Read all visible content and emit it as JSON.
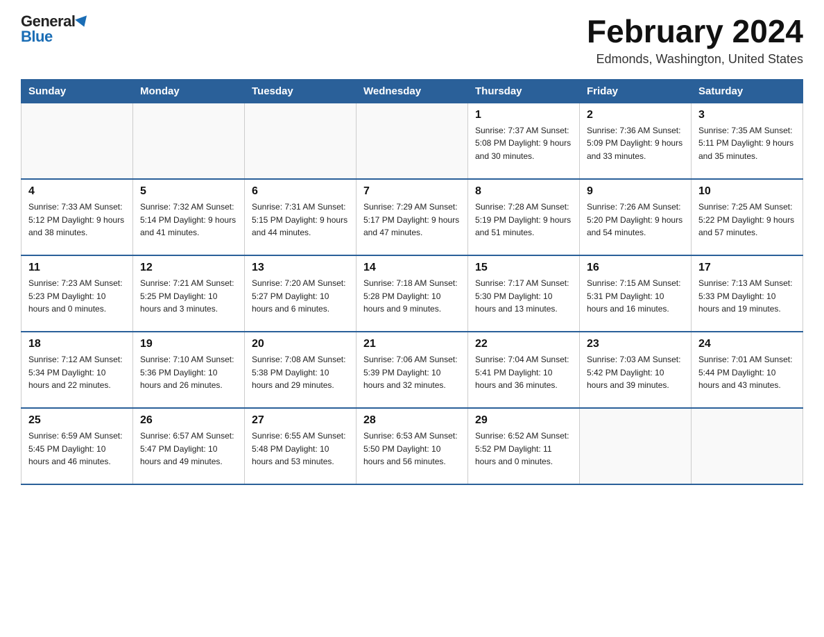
{
  "header": {
    "logo_general": "General",
    "logo_blue": "Blue",
    "title": "February 2024",
    "subtitle": "Edmonds, Washington, United States"
  },
  "days_of_week": [
    "Sunday",
    "Monday",
    "Tuesday",
    "Wednesday",
    "Thursday",
    "Friday",
    "Saturday"
  ],
  "weeks": [
    [
      {
        "day": "",
        "info": ""
      },
      {
        "day": "",
        "info": ""
      },
      {
        "day": "",
        "info": ""
      },
      {
        "day": "",
        "info": ""
      },
      {
        "day": "1",
        "info": "Sunrise: 7:37 AM\nSunset: 5:08 PM\nDaylight: 9 hours\nand 30 minutes."
      },
      {
        "day": "2",
        "info": "Sunrise: 7:36 AM\nSunset: 5:09 PM\nDaylight: 9 hours\nand 33 minutes."
      },
      {
        "day": "3",
        "info": "Sunrise: 7:35 AM\nSunset: 5:11 PM\nDaylight: 9 hours\nand 35 minutes."
      }
    ],
    [
      {
        "day": "4",
        "info": "Sunrise: 7:33 AM\nSunset: 5:12 PM\nDaylight: 9 hours\nand 38 minutes."
      },
      {
        "day": "5",
        "info": "Sunrise: 7:32 AM\nSunset: 5:14 PM\nDaylight: 9 hours\nand 41 minutes."
      },
      {
        "day": "6",
        "info": "Sunrise: 7:31 AM\nSunset: 5:15 PM\nDaylight: 9 hours\nand 44 minutes."
      },
      {
        "day": "7",
        "info": "Sunrise: 7:29 AM\nSunset: 5:17 PM\nDaylight: 9 hours\nand 47 minutes."
      },
      {
        "day": "8",
        "info": "Sunrise: 7:28 AM\nSunset: 5:19 PM\nDaylight: 9 hours\nand 51 minutes."
      },
      {
        "day": "9",
        "info": "Sunrise: 7:26 AM\nSunset: 5:20 PM\nDaylight: 9 hours\nand 54 minutes."
      },
      {
        "day": "10",
        "info": "Sunrise: 7:25 AM\nSunset: 5:22 PM\nDaylight: 9 hours\nand 57 minutes."
      }
    ],
    [
      {
        "day": "11",
        "info": "Sunrise: 7:23 AM\nSunset: 5:23 PM\nDaylight: 10 hours\nand 0 minutes."
      },
      {
        "day": "12",
        "info": "Sunrise: 7:21 AM\nSunset: 5:25 PM\nDaylight: 10 hours\nand 3 minutes."
      },
      {
        "day": "13",
        "info": "Sunrise: 7:20 AM\nSunset: 5:27 PM\nDaylight: 10 hours\nand 6 minutes."
      },
      {
        "day": "14",
        "info": "Sunrise: 7:18 AM\nSunset: 5:28 PM\nDaylight: 10 hours\nand 9 minutes."
      },
      {
        "day": "15",
        "info": "Sunrise: 7:17 AM\nSunset: 5:30 PM\nDaylight: 10 hours\nand 13 minutes."
      },
      {
        "day": "16",
        "info": "Sunrise: 7:15 AM\nSunset: 5:31 PM\nDaylight: 10 hours\nand 16 minutes."
      },
      {
        "day": "17",
        "info": "Sunrise: 7:13 AM\nSunset: 5:33 PM\nDaylight: 10 hours\nand 19 minutes."
      }
    ],
    [
      {
        "day": "18",
        "info": "Sunrise: 7:12 AM\nSunset: 5:34 PM\nDaylight: 10 hours\nand 22 minutes."
      },
      {
        "day": "19",
        "info": "Sunrise: 7:10 AM\nSunset: 5:36 PM\nDaylight: 10 hours\nand 26 minutes."
      },
      {
        "day": "20",
        "info": "Sunrise: 7:08 AM\nSunset: 5:38 PM\nDaylight: 10 hours\nand 29 minutes."
      },
      {
        "day": "21",
        "info": "Sunrise: 7:06 AM\nSunset: 5:39 PM\nDaylight: 10 hours\nand 32 minutes."
      },
      {
        "day": "22",
        "info": "Sunrise: 7:04 AM\nSunset: 5:41 PM\nDaylight: 10 hours\nand 36 minutes."
      },
      {
        "day": "23",
        "info": "Sunrise: 7:03 AM\nSunset: 5:42 PM\nDaylight: 10 hours\nand 39 minutes."
      },
      {
        "day": "24",
        "info": "Sunrise: 7:01 AM\nSunset: 5:44 PM\nDaylight: 10 hours\nand 43 minutes."
      }
    ],
    [
      {
        "day": "25",
        "info": "Sunrise: 6:59 AM\nSunset: 5:45 PM\nDaylight: 10 hours\nand 46 minutes."
      },
      {
        "day": "26",
        "info": "Sunrise: 6:57 AM\nSunset: 5:47 PM\nDaylight: 10 hours\nand 49 minutes."
      },
      {
        "day": "27",
        "info": "Sunrise: 6:55 AM\nSunset: 5:48 PM\nDaylight: 10 hours\nand 53 minutes."
      },
      {
        "day": "28",
        "info": "Sunrise: 6:53 AM\nSunset: 5:50 PM\nDaylight: 10 hours\nand 56 minutes."
      },
      {
        "day": "29",
        "info": "Sunrise: 6:52 AM\nSunset: 5:52 PM\nDaylight: 11 hours\nand 0 minutes."
      },
      {
        "day": "",
        "info": ""
      },
      {
        "day": "",
        "info": ""
      }
    ]
  ]
}
